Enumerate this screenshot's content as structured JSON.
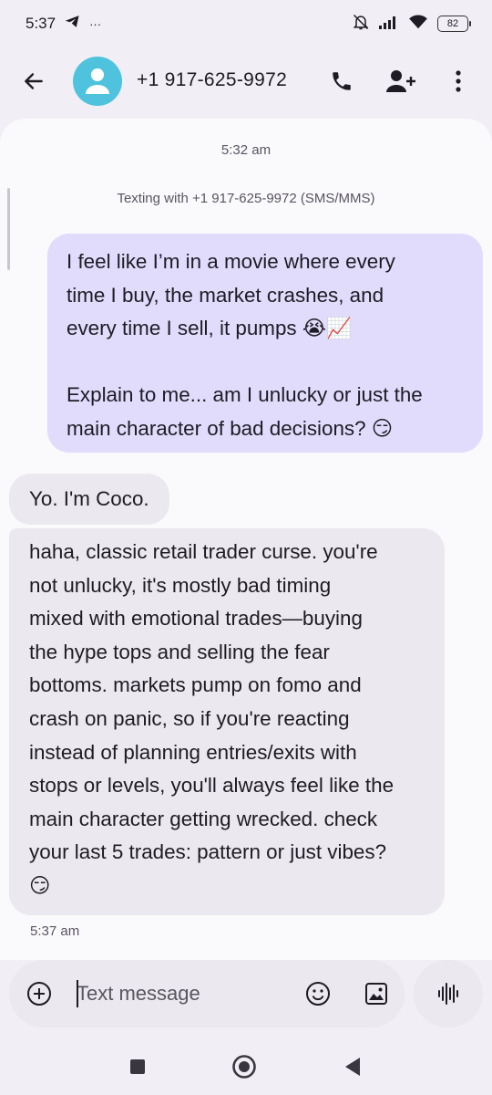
{
  "status_bar": {
    "time": "5:37",
    "extra": "···",
    "battery": "82"
  },
  "header": {
    "contact": "+1 917-625-9972"
  },
  "conversation": {
    "timestamp_top": "5:32 am",
    "texting_with": "Texting with +1 917-625-9972 (SMS/MMS)",
    "messages": [
      {
        "direction": "outgoing",
        "text": "I feel like I’m in a movie where every\ntime I buy, the market crashes, and\nevery time I sell, it pumps 😭📈\n\nExplain to me... am I unlucky or just the\nmain character of bad decisions? 😏"
      },
      {
        "direction": "incoming",
        "text": "Yo. I'm Coco."
      },
      {
        "direction": "incoming",
        "text": "haha, classic retail trader curse. you're\nnot unlucky, it's mostly bad timing\nmixed with emotional trades—buying\nthe hype tops and selling the fear\nbottoms. markets pump on fomo and\ncrash on panic, so if you're reacting\ninstead of planning entries/exits with\nstops or levels, you'll always feel like the\nmain character getting wrecked. check\nyour last 5 trades: pattern or just vibes?\n😏"
      }
    ],
    "timestamp_bottom": "5:37 am"
  },
  "composer": {
    "placeholder": "Text message"
  },
  "colors": {
    "outgoing_bubble": "#e1dcfc",
    "incoming_bubble": "#ebe9ef",
    "avatar": "#4fc3dd"
  },
  "icons": {
    "back": "arrow-left-icon",
    "avatar": "person-icon",
    "call": "phone-icon",
    "add_contact": "person-add-icon",
    "more": "more-vertical-icon",
    "attach": "plus-circle-icon",
    "emoji": "emoji-icon",
    "gallery": "image-icon",
    "voice": "voice-waveform-icon"
  }
}
